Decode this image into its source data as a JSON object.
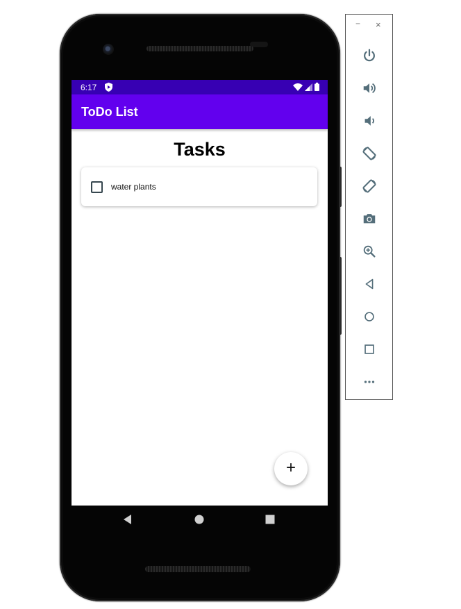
{
  "status_bar": {
    "time": "6:17"
  },
  "app_bar": {
    "title": "ToDo List"
  },
  "main": {
    "heading": "Tasks",
    "tasks": [
      {
        "label": "water plants",
        "checked": false
      }
    ],
    "fab_label": "+"
  },
  "nav_bar": {
    "buttons": [
      "back-icon",
      "home-icon",
      "recents-icon"
    ]
  },
  "emulator_toolbar": {
    "minimize_label": "−",
    "close_label": "×",
    "buttons": [
      "power-icon",
      "volume-up-icon",
      "volume-down-icon",
      "rotate-left-icon",
      "rotate-right-icon",
      "camera-icon",
      "zoom-icon",
      "back-icon",
      "home-icon",
      "overview-icon",
      "more-icon"
    ]
  },
  "colors": {
    "status_bar": "#3700b3",
    "app_bar": "#6200ee",
    "toolbar_icon": "#546e7a"
  }
}
